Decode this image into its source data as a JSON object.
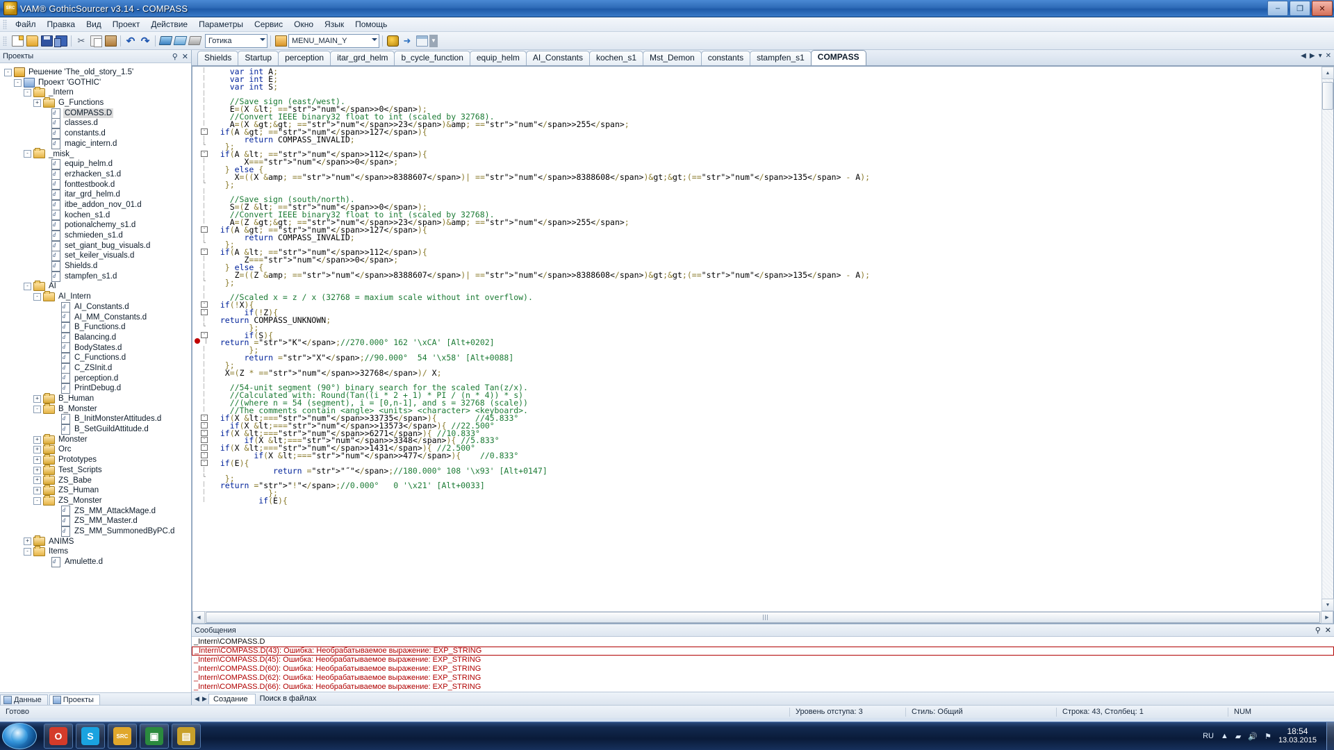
{
  "window": {
    "title": "VAM® GothicSourcer v3.14 - COMPASS",
    "icon": "app-icon",
    "minimize": "–",
    "maximize": "❐",
    "close": "✕"
  },
  "menu": {
    "items": [
      "Файл",
      "Правка",
      "Вид",
      "Проект",
      "Действие",
      "Параметры",
      "Сервис",
      "Окно",
      "Язык",
      "Помощь"
    ]
  },
  "toolbar": {
    "buttons": [
      {
        "name": "new-file-icon",
        "glyph": ""
      },
      {
        "name": "open-file-icon",
        "glyph": ""
      },
      {
        "name": "save-icon",
        "glyph": ""
      },
      {
        "name": "save-all-icon",
        "glyph": ""
      },
      {
        "name": "cut-icon",
        "glyph": "✂"
      },
      {
        "name": "copy-icon",
        "glyph": ""
      },
      {
        "name": "paste-icon",
        "glyph": ""
      },
      {
        "name": "undo-icon",
        "glyph": "↶"
      },
      {
        "name": "redo-icon",
        "glyph": "↷"
      },
      {
        "name": "compile-icon",
        "glyph": ""
      },
      {
        "name": "build-icon",
        "glyph": ""
      },
      {
        "name": "rebuild-icon",
        "glyph": ""
      }
    ],
    "game_combo_value": "Готика",
    "symbol_combo_value": "MENU_MAIN_Y",
    "right_buttons": [
      {
        "name": "run-game-icon",
        "glyph": ""
      },
      {
        "name": "goto-icon",
        "glyph": "➜"
      },
      {
        "name": "window-icon",
        "glyph": ""
      },
      {
        "name": "toolbar-overflow-icon",
        "glyph": "▼"
      }
    ]
  },
  "projects_panel": {
    "title": "Проекты",
    "pin": "⚲",
    "close": "✕",
    "tree": [
      {
        "depth": 0,
        "expander": "-",
        "icon": "solution",
        "label": "Решение 'The_old_story_1.5'",
        "selected": false
      },
      {
        "depth": 1,
        "expander": "-",
        "icon": "project",
        "label": "Проект 'GOTHIC'",
        "selected": false
      },
      {
        "depth": 2,
        "expander": "-",
        "icon": "folder-open",
        "label": "_Intern",
        "selected": false
      },
      {
        "depth": 3,
        "expander": "+",
        "icon": "folder",
        "label": "G_Functions",
        "selected": false
      },
      {
        "depth": 4,
        "expander": "",
        "icon": "file",
        "label": "COMPASS.D",
        "selected": true
      },
      {
        "depth": 4,
        "expander": "",
        "icon": "file",
        "label": "classes.d",
        "selected": false
      },
      {
        "depth": 4,
        "expander": "",
        "icon": "file",
        "label": "constants.d",
        "selected": false
      },
      {
        "depth": 4,
        "expander": "",
        "icon": "file",
        "label": "magic_intern.d",
        "selected": false
      },
      {
        "depth": 2,
        "expander": "-",
        "icon": "folder-open",
        "label": "_misk_",
        "selected": false
      },
      {
        "depth": 4,
        "expander": "",
        "icon": "file",
        "label": "equip_helm.d",
        "selected": false
      },
      {
        "depth": 4,
        "expander": "",
        "icon": "file",
        "label": "erzhacken_s1.d",
        "selected": false
      },
      {
        "depth": 4,
        "expander": "",
        "icon": "file",
        "label": "fonttestbook.d",
        "selected": false
      },
      {
        "depth": 4,
        "expander": "",
        "icon": "file",
        "label": "itar_grd_helm.d",
        "selected": false
      },
      {
        "depth": 4,
        "expander": "",
        "icon": "file",
        "label": "itbe_addon_nov_01.d",
        "selected": false
      },
      {
        "depth": 4,
        "expander": "",
        "icon": "file",
        "label": "kochen_s1.d",
        "selected": false
      },
      {
        "depth": 4,
        "expander": "",
        "icon": "file",
        "label": "potionalchemy_s1.d",
        "selected": false
      },
      {
        "depth": 4,
        "expander": "",
        "icon": "file",
        "label": "schmieden_s1.d",
        "selected": false
      },
      {
        "depth": 4,
        "expander": "",
        "icon": "file",
        "label": "set_giant_bug_visuals.d",
        "selected": false
      },
      {
        "depth": 4,
        "expander": "",
        "icon": "file",
        "label": "set_keiler_visuals.d",
        "selected": false
      },
      {
        "depth": 4,
        "expander": "",
        "icon": "file",
        "label": "Shields.d",
        "selected": false
      },
      {
        "depth": 4,
        "expander": "",
        "icon": "file",
        "label": "stampfen_s1.d",
        "selected": false
      },
      {
        "depth": 2,
        "expander": "-",
        "icon": "folder-open",
        "label": "AI",
        "selected": false
      },
      {
        "depth": 3,
        "expander": "-",
        "icon": "folder-open",
        "label": "AI_Intern",
        "selected": false
      },
      {
        "depth": 5,
        "expander": "",
        "icon": "file",
        "label": "AI_Constants.d",
        "selected": false
      },
      {
        "depth": 5,
        "expander": "",
        "icon": "file",
        "label": "AI_MM_Constants.d",
        "selected": false
      },
      {
        "depth": 5,
        "expander": "",
        "icon": "file",
        "label": "B_Functions.d",
        "selected": false
      },
      {
        "depth": 5,
        "expander": "",
        "icon": "file",
        "label": "Balancing.d",
        "selected": false
      },
      {
        "depth": 5,
        "expander": "",
        "icon": "file",
        "label": "BodyStates.d",
        "selected": false
      },
      {
        "depth": 5,
        "expander": "",
        "icon": "file",
        "label": "C_Functions.d",
        "selected": false
      },
      {
        "depth": 5,
        "expander": "",
        "icon": "file",
        "label": "C_ZSInit.d",
        "selected": false
      },
      {
        "depth": 5,
        "expander": "",
        "icon": "file",
        "label": "perception.d",
        "selected": false
      },
      {
        "depth": 5,
        "expander": "",
        "icon": "file",
        "label": "PrintDebug.d",
        "selected": false
      },
      {
        "depth": 3,
        "expander": "+",
        "icon": "folder",
        "label": "B_Human",
        "selected": false
      },
      {
        "depth": 3,
        "expander": "-",
        "icon": "folder-open",
        "label": "B_Monster",
        "selected": false
      },
      {
        "depth": 5,
        "expander": "",
        "icon": "file",
        "label": "B_InitMonsterAttitudes.d",
        "selected": false
      },
      {
        "depth": 5,
        "expander": "",
        "icon": "file",
        "label": "B_SetGuildAttitude.d",
        "selected": false
      },
      {
        "depth": 3,
        "expander": "+",
        "icon": "folder",
        "label": "Monster",
        "selected": false
      },
      {
        "depth": 3,
        "expander": "+",
        "icon": "folder",
        "label": "Orc",
        "selected": false
      },
      {
        "depth": 3,
        "expander": "+",
        "icon": "folder",
        "label": "Prototypes",
        "selected": false
      },
      {
        "depth": 3,
        "expander": "+",
        "icon": "folder",
        "label": "Test_Scripts",
        "selected": false
      },
      {
        "depth": 3,
        "expander": "+",
        "icon": "folder",
        "label": "ZS_Babe",
        "selected": false
      },
      {
        "depth": 3,
        "expander": "+",
        "icon": "folder",
        "label": "ZS_Human",
        "selected": false
      },
      {
        "depth": 3,
        "expander": "-",
        "icon": "folder-open",
        "label": "ZS_Monster",
        "selected": false
      },
      {
        "depth": 5,
        "expander": "",
        "icon": "file",
        "label": "ZS_MM_AttackMage.d",
        "selected": false
      },
      {
        "depth": 5,
        "expander": "",
        "icon": "file",
        "label": "ZS_MM_Master.d",
        "selected": false
      },
      {
        "depth": 5,
        "expander": "",
        "icon": "file",
        "label": "ZS_MM_SummonedByPC.d",
        "selected": false
      },
      {
        "depth": 2,
        "expander": "+",
        "icon": "folder",
        "label": "ANIMS",
        "selected": false
      },
      {
        "depth": 2,
        "expander": "-",
        "icon": "folder-open",
        "label": "Items",
        "selected": false
      },
      {
        "depth": 4,
        "expander": "",
        "icon": "file",
        "label": "Amulette.d",
        "selected": false
      }
    ],
    "bottom_tabs": [
      {
        "label": "Данные",
        "active": false
      },
      {
        "label": "Проекты",
        "active": true
      }
    ]
  },
  "editor": {
    "tabs": [
      {
        "label": "Shields",
        "active": false
      },
      {
        "label": "Startup",
        "active": false
      },
      {
        "label": "perception",
        "active": false
      },
      {
        "label": "itar_grd_helm",
        "active": false
      },
      {
        "label": "b_cycle_function",
        "active": false
      },
      {
        "label": "equip_helm",
        "active": false
      },
      {
        "label": "AI_Constants",
        "active": false
      },
      {
        "label": "kochen_s1",
        "active": false
      },
      {
        "label": "Mst_Demon",
        "active": false
      },
      {
        "label": "constants",
        "active": false
      },
      {
        "label": "stampfen_s1",
        "active": false
      },
      {
        "label": "COMPASS",
        "active": true
      }
    ],
    "tab_nav": {
      "prev": "◀",
      "next": "▶",
      "list": "▾",
      "close": "✕"
    },
    "lines": [
      {
        "fold": "",
        "bp": false,
        "text": "    var int A;"
      },
      {
        "fold": "",
        "bp": false,
        "text": "    var int E;"
      },
      {
        "fold": "",
        "bp": false,
        "text": "    var int S;"
      },
      {
        "fold": "",
        "bp": false,
        "text": ""
      },
      {
        "fold": "",
        "bp": false,
        "text": "    //Save sign (east/west)."
      },
      {
        "fold": "",
        "bp": false,
        "text": "    E=(X < 0);"
      },
      {
        "fold": "",
        "bp": false,
        "text": "    //Convert IEEE binary32 float to int (scaled by 32768)."
      },
      {
        "fold": "",
        "bp": false,
        "text": "    A=(X >> 23)& 255;"
      },
      {
        "fold": "-",
        "bp": false,
        "text": "  if(A > 127){"
      },
      {
        "fold": "",
        "bp": false,
        "text": "       return COMPASS_INVALID;"
      },
      {
        "fold": "└",
        "bp": false,
        "text": "   };"
      },
      {
        "fold": "-",
        "bp": false,
        "text": "  if(A < 112){"
      },
      {
        "fold": "",
        "bp": false,
        "text": "       X=0;"
      },
      {
        "fold": "",
        "bp": false,
        "text": "   } else {"
      },
      {
        "fold": "",
        "bp": false,
        "text": "     X=((X & 8388607)| 8388608)>>(135 - A);"
      },
      {
        "fold": "└",
        "bp": false,
        "text": "   };"
      },
      {
        "fold": "",
        "bp": false,
        "text": ""
      },
      {
        "fold": "",
        "bp": false,
        "text": "    //Save sign (south/north)."
      },
      {
        "fold": "",
        "bp": false,
        "text": "    S=(Z < 0);"
      },
      {
        "fold": "",
        "bp": false,
        "text": "    //Convert IEEE binary32 float to int (scaled by 32768)."
      },
      {
        "fold": "",
        "bp": false,
        "text": "    A=(Z >> 23)& 255;"
      },
      {
        "fold": "-",
        "bp": false,
        "text": "  if(A > 127){"
      },
      {
        "fold": "",
        "bp": false,
        "text": "       return COMPASS_INVALID;"
      },
      {
        "fold": "└",
        "bp": false,
        "text": "   };"
      },
      {
        "fold": "-",
        "bp": false,
        "text": "  if(A < 112){"
      },
      {
        "fold": "",
        "bp": false,
        "text": "       Z=0;"
      },
      {
        "fold": "",
        "bp": false,
        "text": "   } else {"
      },
      {
        "fold": "",
        "bp": false,
        "text": "     Z=((Z & 8388607)| 8388608)>>(135 - A);"
      },
      {
        "fold": "└",
        "bp": false,
        "text": "   };"
      },
      {
        "fold": "",
        "bp": false,
        "text": ""
      },
      {
        "fold": "",
        "bp": false,
        "text": "    //Scaled x = z / x (32768 = maxium scale without int overflow)."
      },
      {
        "fold": "-",
        "bp": false,
        "text": "  if(!X){"
      },
      {
        "fold": "-",
        "bp": false,
        "text": "       if(!Z){"
      },
      {
        "fold": "",
        "bp": false,
        "text": "  return COMPASS_UNKNOWN;"
      },
      {
        "fold": "└",
        "bp": false,
        "text": "        };"
      },
      {
        "fold": "-",
        "bp": false,
        "text": "       if(S){"
      },
      {
        "fold": "",
        "bp": true,
        "text": "  return \"K\";//270.000° 162 '\\xCA' [Alt+0202]"
      },
      {
        "fold": "",
        "bp": false,
        "text": "        };"
      },
      {
        "fold": "",
        "bp": false,
        "text": "       return \"X\";//90.000°  54 '\\x58' [Alt+0088]"
      },
      {
        "fold": "",
        "bp": false,
        "text": "   };"
      },
      {
        "fold": "",
        "bp": false,
        "text": "   X=(Z * 32768)/ X;"
      },
      {
        "fold": "",
        "bp": false,
        "text": ""
      },
      {
        "fold": "",
        "bp": false,
        "text": "    //54-unit segment (90°) binary search for the scaled Tan(z/x)."
      },
      {
        "fold": "",
        "bp": false,
        "text": "    //Calculated with: Round(Tan((i * 2 + 1) * PI / (n * 4)) * s)"
      },
      {
        "fold": "",
        "bp": false,
        "text": "    //(where n = 54 (segment), i = [0,n-1], and s = 32768 (scale))"
      },
      {
        "fold": "",
        "bp": false,
        "text": "    //The comments contain <angle> <units> <character> <keyboard>."
      },
      {
        "fold": "-",
        "bp": false,
        "text": "  if(X <=33735){        //45.833°"
      },
      {
        "fold": "-",
        "bp": false,
        "text": "    if(X <=13573){ //22.500°"
      },
      {
        "fold": "-",
        "bp": false,
        "text": "  if(X <=6271){ //10.833°"
      },
      {
        "fold": "-",
        "bp": false,
        "text": "       if(X <=3348){ //5.833°"
      },
      {
        "fold": "-",
        "bp": false,
        "text": "  if(X <=1431){ //2.500°"
      },
      {
        "fold": "-",
        "bp": false,
        "text": "         if(X <=477){    //0.833°"
      },
      {
        "fold": "-",
        "bp": false,
        "text": "  if(E){"
      },
      {
        "fold": "",
        "bp": false,
        "text": "             return \"˝\";//180.000° 108 '\\x93' [Alt+0147]"
      },
      {
        "fold": "└",
        "bp": false,
        "text": "   };"
      },
      {
        "fold": "",
        "bp": false,
        "text": "  return \"!\";//0.000°   0 '\\x21' [Alt+0033]"
      },
      {
        "fold": "",
        "bp": false,
        "text": "            };"
      },
      {
        "fold": "",
        "bp": false,
        "text": "          if(E){"
      }
    ],
    "hscroll_mark": "⋮⋮"
  },
  "messages": {
    "title": "Сообщения",
    "pin": "⚲",
    "close": "✕",
    "rows": [
      {
        "text": "_Intern\\COMPASS.D",
        "error": false,
        "selected": false
      },
      {
        "text": "_Intern\\COMPASS.D(43):  Ошибка: Необрабатываемое выражение: EXP_STRING",
        "error": true,
        "selected": true
      },
      {
        "text": "_Intern\\COMPASS.D(45):  Ошибка: Необрабатываемое выражение: EXP_STRING",
        "error": true,
        "selected": false
      },
      {
        "text": "_Intern\\COMPASS.D(60):  Ошибка: Необрабатываемое выражение: EXP_STRING",
        "error": true,
        "selected": false
      },
      {
        "text": "_Intern\\COMPASS.D(62):  Ошибка: Необрабатываемое выражение: EXP_STRING",
        "error": true,
        "selected": false
      },
      {
        "text": "_Intern\\COMPASS.D(66):  Ошибка: Необрабатываемое выражение: EXP_STRING",
        "error": true,
        "selected": false
      }
    ],
    "tabs": [
      {
        "label": "Создание",
        "active": true
      },
      {
        "label": "Поиск в файлах",
        "active": false
      }
    ],
    "nav": {
      "prev": "◀",
      "next": "▶"
    }
  },
  "statusbar": {
    "state": "Готово",
    "indent": "Уровень отступа: 3",
    "style": "Стиль: Общий",
    "position": "Строка: 43, Столбец: 1",
    "num": "NUM"
  },
  "taskbar": {
    "start": "start-orb",
    "items": [
      {
        "name": "opera-icon",
        "glyph": "O"
      },
      {
        "name": "skype-icon",
        "glyph": "S"
      },
      {
        "name": "gothicsourcer-icon",
        "glyph": "SRC"
      },
      {
        "name": "media-icon",
        "glyph": "▣"
      },
      {
        "name": "explorer-icon",
        "glyph": "▤"
      }
    ],
    "tray": {
      "lang": "RU",
      "overflow": "▲",
      "icons": [
        {
          "name": "network-icon",
          "glyph": "▰"
        },
        {
          "name": "volume-icon",
          "glyph": "🔊"
        },
        {
          "name": "action-center-icon",
          "glyph": "⚑"
        }
      ],
      "time": "18:54",
      "date": "13.03.2015"
    }
  },
  "colors": {
    "accent": "#2f6cb8",
    "error": "#b00000",
    "keyword": "#00229a",
    "comment": "#1a7a33",
    "number": "#3a7fbf"
  }
}
